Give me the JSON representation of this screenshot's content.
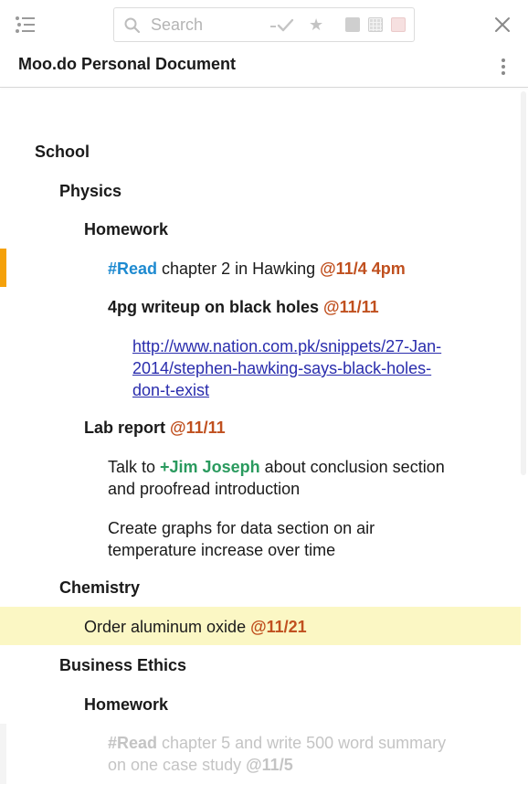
{
  "toolbar": {
    "menu_icon": "list-menu-icon",
    "search": {
      "placeholder": "Search",
      "value": ""
    },
    "filters": {
      "done_icon": "dash-check-icon",
      "star_icon": "star-icon",
      "swatches": [
        "#cfcfcf",
        "#dcdcdc",
        "#f6e0e0"
      ]
    },
    "close_icon": "close-icon"
  },
  "document": {
    "title": "Moo.do Personal Document",
    "more_icon": "vertical-dots-icon"
  },
  "outline": {
    "school": "School",
    "physics": "Physics",
    "homework1": "Homework",
    "read_item": {
      "tag": "#Read",
      "text": " chapter 2 in Hawking ",
      "date": "@11/4 4pm"
    },
    "writeup": {
      "text": "4pg writeup on black holes ",
      "date": "@11/11"
    },
    "link": {
      "line1": "http://www.nation.com.pk/snippets/27-Jan-",
      "line2": "2014/stephen-hawking-says-black-holes-",
      "line3": "don-t-exist"
    },
    "lab_report": {
      "text": "Lab report ",
      "date": "@11/11"
    },
    "talk": {
      "pre": "Talk to ",
      "person": "+Jim Joseph",
      "post": " about conclusion section",
      "line2": "and proofread introduction"
    },
    "graphs": {
      "line1": "Create graphs for data section on air",
      "line2": "temperature increase over time"
    },
    "chemistry": "Chemistry",
    "order": {
      "text": "Order aluminum oxide ",
      "date": "@11/21"
    },
    "business_ethics": "Business Ethics",
    "homework2": "Homework",
    "read_item2": {
      "tag": "#Read",
      "text": " chapter 5 and write 500 word summary",
      "line2": "on one case study ",
      "date": "@11/5"
    }
  },
  "colors": {
    "tag": "#1e8ad0",
    "date": "#c0501f",
    "person": "#2a9a5e",
    "link": "#2a2dad",
    "priority_mark": "#f5a10a",
    "selected_row": "#fbf7c4"
  }
}
